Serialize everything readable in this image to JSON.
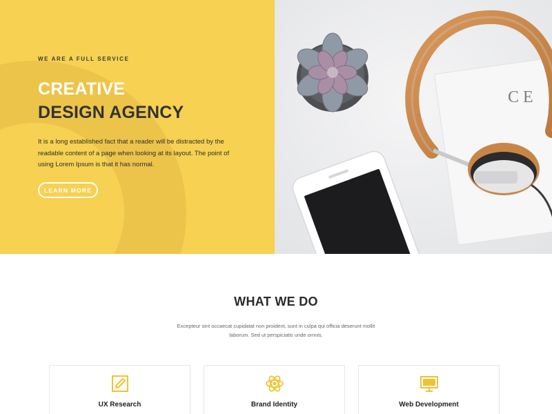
{
  "hero": {
    "eyebrow": "WE ARE A FULL SERVICE",
    "headline_line1": "CREATIVE",
    "headline_line2": "DESIGN AGENCY",
    "description": "It is a long established fact that a reader will be distracted by the readable content of a page when looking at its layout. The point of using Lorem Ipsum is that it has normal.",
    "cta_label": "LEARN MORE",
    "book_text": "CE"
  },
  "services": {
    "title": "WHAT WE DO",
    "subtitle": "Excepteur sint occaecat cupidatat non proident, sunt in culpa qui officia deserunt mollit laborum. Sed ut perspiciatis unde omnis.",
    "items": [
      {
        "label": "UX Research",
        "icon": "pencil-icon"
      },
      {
        "label": "Brand Identity",
        "icon": "atom-icon"
      },
      {
        "label": "Web Development",
        "icon": "monitor-icon"
      }
    ]
  },
  "colors": {
    "accent": "#f6d152",
    "accent_dark": "#ecc44a",
    "icon": "#f2c230",
    "text_dark": "#2a2a2a"
  }
}
